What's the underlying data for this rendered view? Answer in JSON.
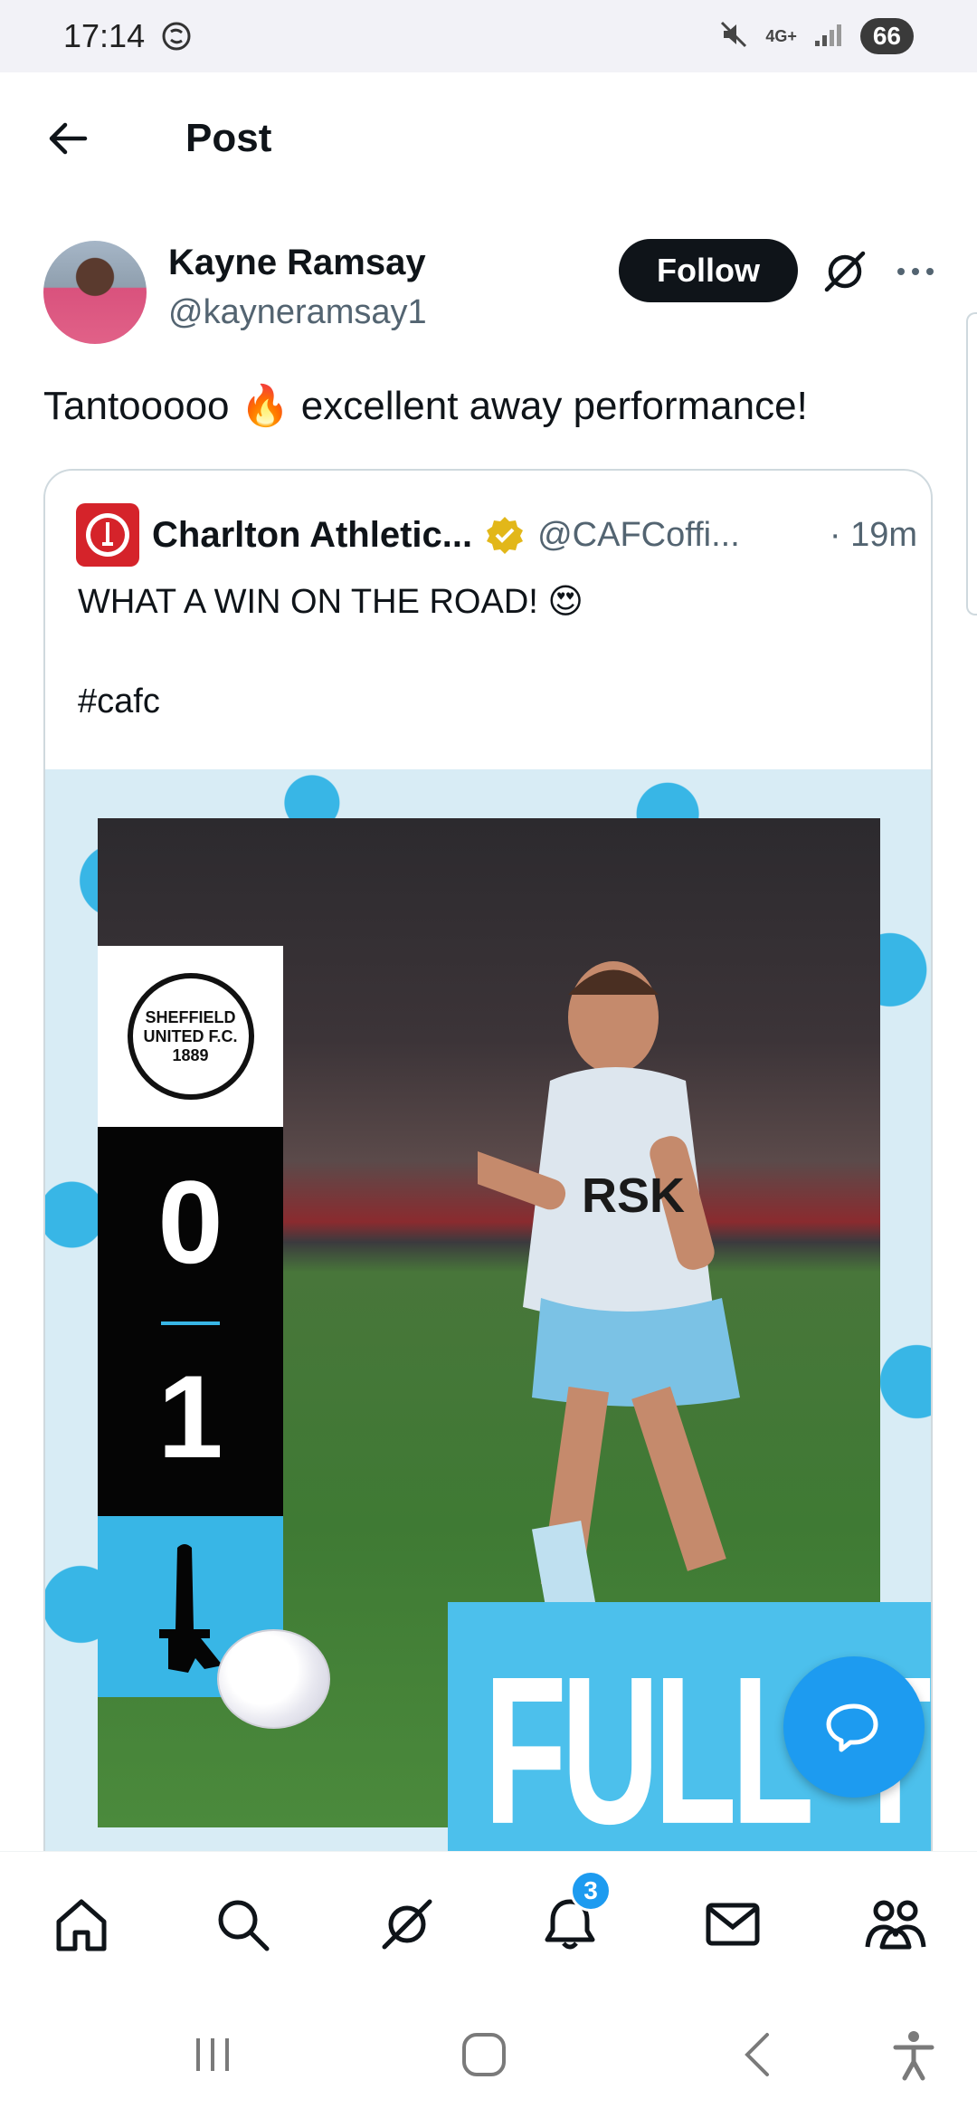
{
  "status_bar": {
    "time": "17:14",
    "network": "4G+",
    "battery": "66"
  },
  "header": {
    "title": "Post"
  },
  "author": {
    "name": "Kayne Ramsay",
    "handle": "@kayneramsay1",
    "follow_label": "Follow"
  },
  "tweet": {
    "text": "Tantooooo 🔥 excellent away performance!"
  },
  "quote": {
    "name": "Charlton Athletic...",
    "handle": "@CAFCoffi...",
    "time": "· 19m",
    "line1": "WHAT A WIN ON THE ROAD! 😍",
    "line2": "#cafc",
    "image": {
      "crest_text": "SHEFFIELD UNITED F.C. 1889",
      "score_home": "0",
      "score_away": "1",
      "banner": "FULL-TIME"
    }
  },
  "bottom_nav": {
    "notifications_badge": "3"
  },
  "colors": {
    "accent": "#1d9bf0",
    "follow_bg": "#0f1419",
    "image_blue": "#38b6e6"
  }
}
